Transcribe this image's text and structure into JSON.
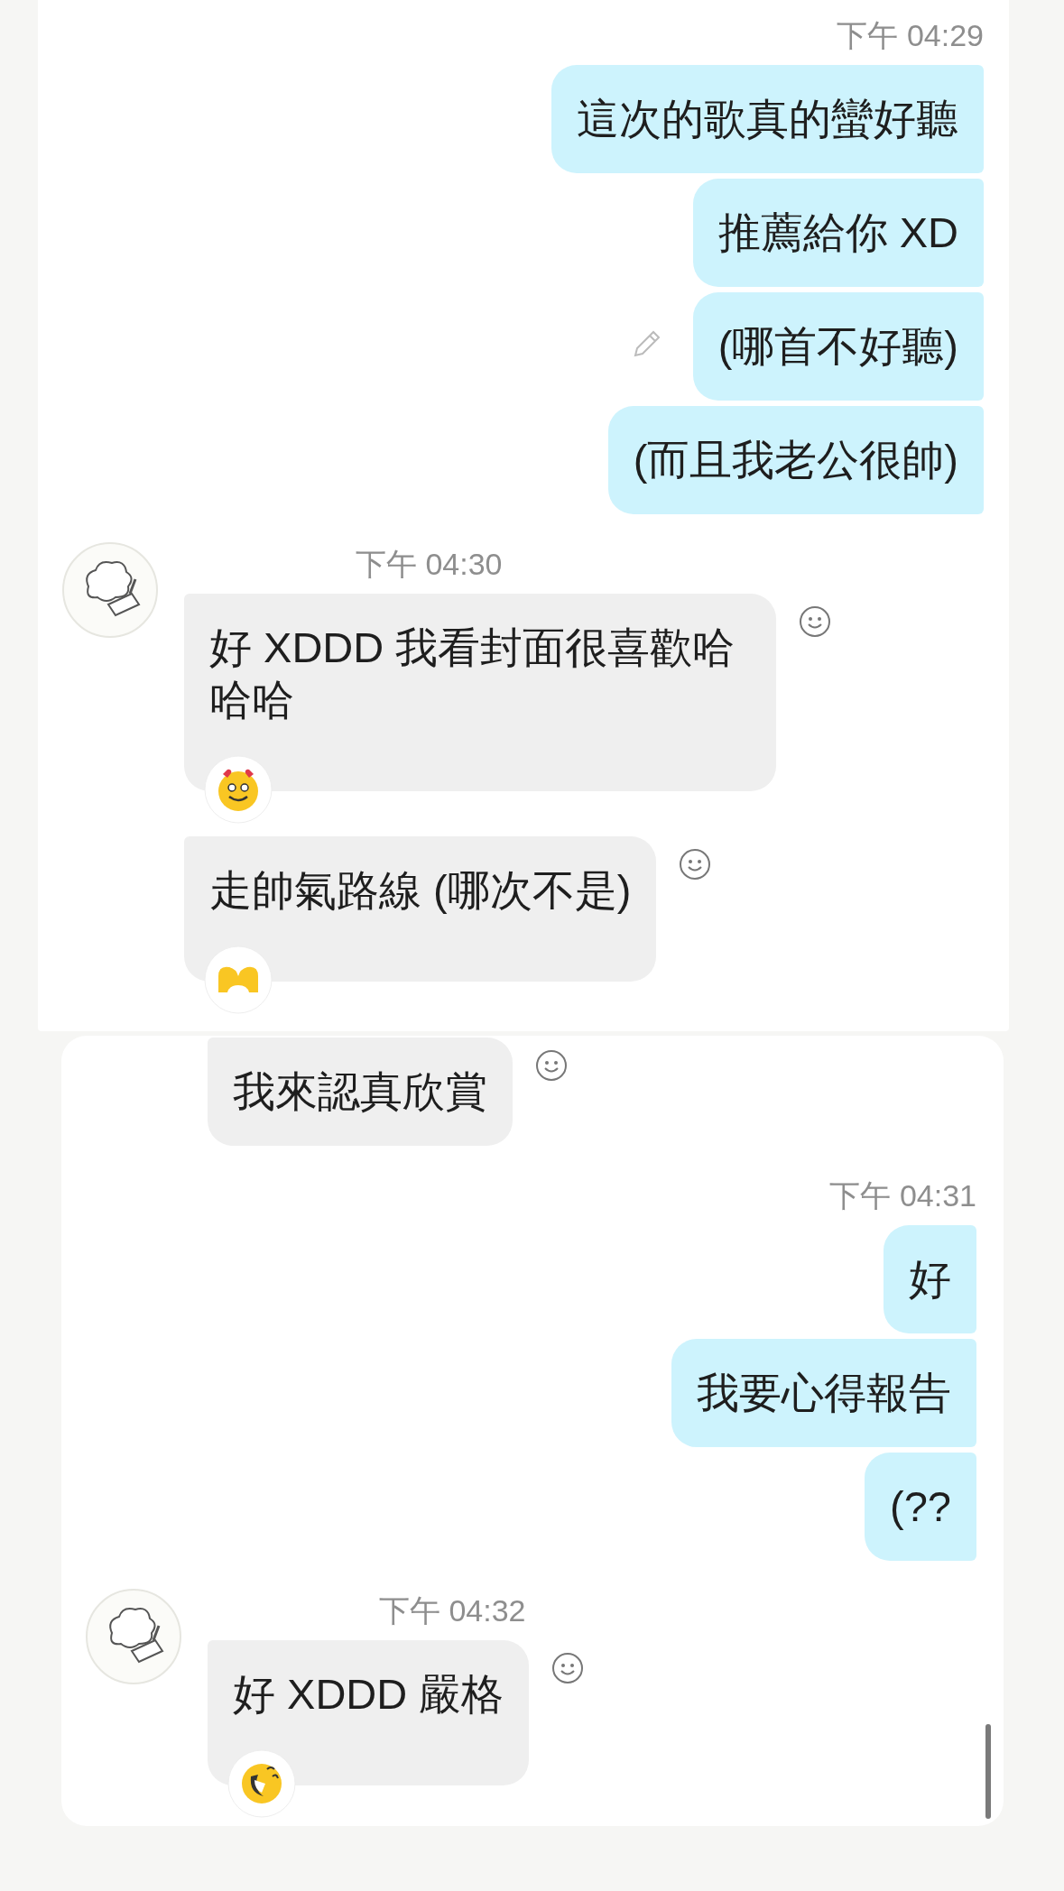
{
  "panels": [
    {
      "groups": [
        {
          "kind": "outgoing",
          "time": "下午 04:29",
          "messages": [
            {
              "text": "這次的歌真的蠻好聽",
              "edited": false
            },
            {
              "text": "推薦給你 XD",
              "edited": false
            },
            {
              "text": "(哪首不好聽)",
              "edited": true
            },
            {
              "text": "(而且我老公很帥)",
              "edited": false
            }
          ]
        },
        {
          "kind": "incoming",
          "time": "下午 04:30",
          "avatar": true,
          "messages": [
            {
              "text": "好 XDDD 我看封面很喜歡哈哈哈",
              "reaction": {
                "kind": "heart-eyes"
              }
            },
            {
              "text": "走帥氣路線 (哪次不是)",
              "reaction": {
                "kind": "heart-hands"
              }
            }
          ]
        }
      ]
    },
    {
      "groups": [
        {
          "kind": "incoming",
          "avatar": false,
          "messages": [
            {
              "text": "我來認真欣賞"
            }
          ]
        },
        {
          "kind": "outgoing",
          "time": "下午 04:31",
          "messages": [
            {
              "text": "好",
              "edited": false
            },
            {
              "text": "我要心得報告",
              "edited": false
            },
            {
              "text": "(??",
              "edited": false
            }
          ]
        },
        {
          "kind": "incoming",
          "time": "下午 04:32",
          "avatar": true,
          "messages": [
            {
              "text": "好 XDDD 嚴格",
              "reaction": {
                "kind": "laughing"
              }
            }
          ]
        }
      ]
    }
  ]
}
